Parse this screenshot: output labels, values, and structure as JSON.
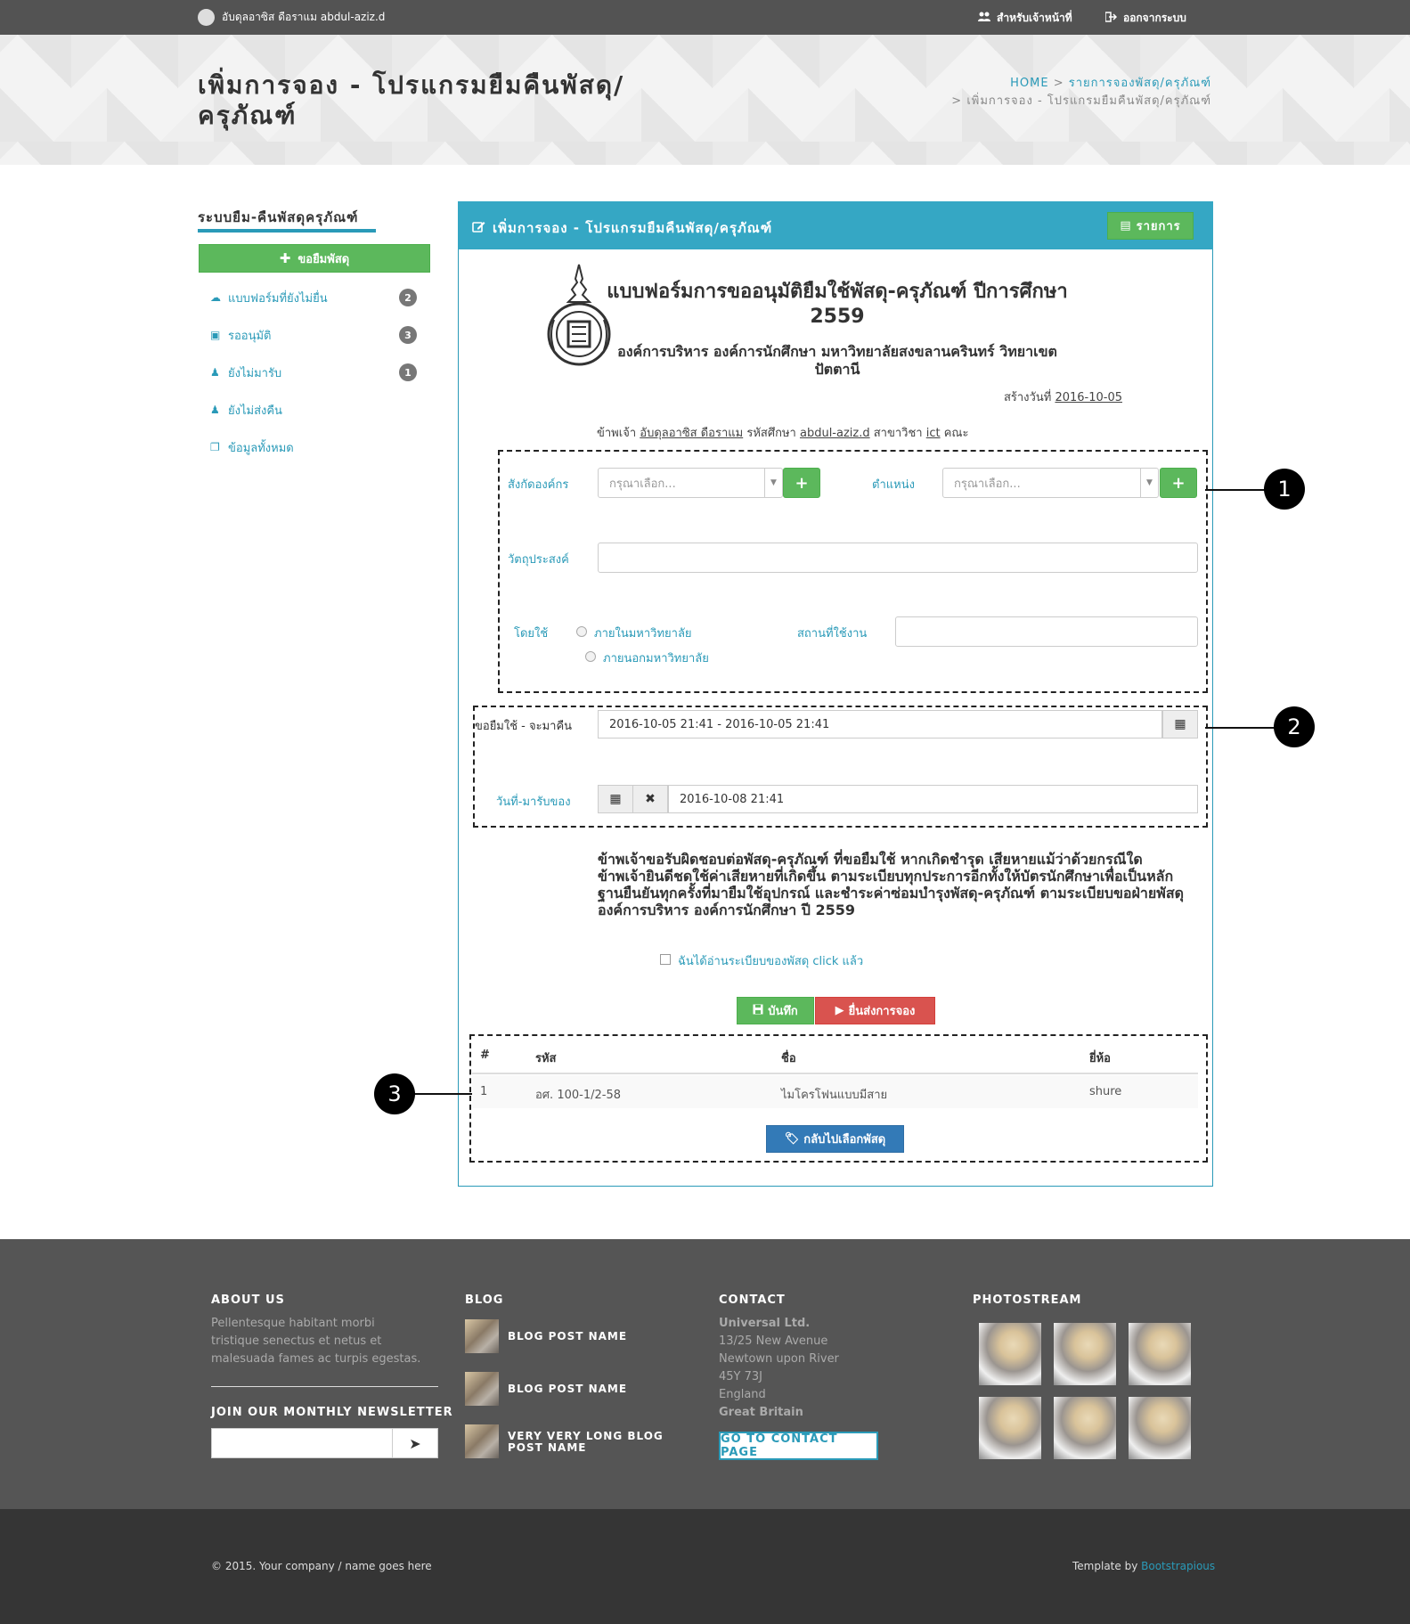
{
  "topbar": {
    "user": "อับดุลอาซิส ดือราแม abdul-aziz.d",
    "staff_link": "สำหรับเจ้าหน้าที่",
    "logout_link": "ออกจากระบบ"
  },
  "header": {
    "title": "เพิ่มการจอง - โปรแกรมยืมคืนพัสดุ/ครุภัณฑ์",
    "breadcrumb": {
      "home": "HOME",
      "list": "รายการจองพัสดุ/ครุภัณฑ์",
      "current": "เพิ่มการจอง - โปรแกรมยืมคืนพัสดุ/ครุภัณฑ์"
    }
  },
  "sidebar": {
    "title": "ระบบยืม-คืนพัสดุครุภัณฑ์",
    "borrow_button": "ขอยืมพัสดุ",
    "items": [
      {
        "label": "แบบฟอร์มที่ยังไม่ยื่น",
        "badge": "2",
        "icon": "cloud-upload-icon"
      },
      {
        "label": "รออนุมัติ",
        "badge": "3",
        "icon": "inbox-icon"
      },
      {
        "label": "ยังไม่มารับ",
        "badge": "1",
        "icon": "user-pickup-icon"
      },
      {
        "label": "ยังไม่ส่งคืน",
        "badge": "",
        "icon": "user-return-icon"
      },
      {
        "label": "ข้อมูลทั้งหมด",
        "badge": "",
        "icon": "files-icon"
      }
    ]
  },
  "panel": {
    "title": "เพิ่มการจอง - โปรแกรมยืมคืนพัสดุ/ครุภัณฑ์",
    "list_button": "รายการ"
  },
  "form": {
    "title": "แบบฟอร์มการขออนุมัติยืมใช้พัสดุ-ครุภัณฑ์ ปีการศึกษา 2559",
    "org": "องค์การบริหาร องค์การนักศึกษา มหาวิทยาลัยสงขลานครินทร์ วิทยาเขตปัตตานี",
    "created_label": "สร้างวันที่",
    "created_date": "2016-10-05",
    "iam_prefix": "ข้าพเจ้า",
    "name": "อับดุลอาซิส ดือราแม",
    "student_id_label": "รหัสศึกษา",
    "student_id": "abdul-aziz.d",
    "major_label": "สาขาวิชา",
    "major": "ict",
    "faculty_label": "คณะ",
    "org_label": "สังกัดองค์กร",
    "org_placeholder": "กรุณาเลือก...",
    "position_label": "ตำแหน่ง",
    "position_placeholder": "กรุณาเลือก...",
    "purpose_label": "วัตถุประสงค์",
    "by_label": "โดยใช้",
    "inside_option": "ภายในมหาวิทยาลัย",
    "outside_option": "ภายนอกมหาวิทยาลัย",
    "location_label": "สถานที่ใช้งาน",
    "borrow_range_label": "ขอยืมใช้ - จะมาคืน",
    "borrow_range_value": "2016-10-05  21:41 - 2016-10-05  21:41",
    "pickup_label": "วันที่-มารับของ",
    "pickup_value": "2016-10-08  21:41",
    "agreement": "ข้าพเจ้าขอรับผิดชอบต่อพัสดุ-ครุภัณฑ์ ที่ขอยืมใช้ หากเกิดชำรุด เสียหายแม้ว่าด้วยกรณีใด ข้าพเจ้ายินดีชดใช้ค่าเสียหายที่เกิดขึ้น ตามระเบียบทุกประการอีกทั้งให้บัตรนักศึกษาเพื่อเป็นหลักฐานยืนยันทุกครั้งที่มายืมใช้อุปกรณ์ และชำระค่าซ่อมบำรุงพัสดุ-ครุภัณฑ์ ตามระเบียบขอฝ่ายพัสดุ องค์การบริหาร องค์การนักศึกษา ปี 2559",
    "checkbox_label": "ฉันได้อ่านระเบียบของพัสดุ click แล้ว",
    "save_button": "บันทึก",
    "submit_button": "ยื่นส่งการจอง",
    "back_button": "กลับไปเลือกพัสดุ"
  },
  "table": {
    "headers": [
      "#",
      "รหัส",
      "ชื่อ",
      "ยี่ห้อ"
    ],
    "rows": [
      [
        "1",
        "อศ. 100-1/2-58",
        "ไมโครโฟนแบบมีสาย",
        "shure"
      ]
    ]
  },
  "callouts": [
    "1",
    "2",
    "3"
  ],
  "footer": {
    "about_title": "ABOUT US",
    "about_text": "Pellentesque habitant morbi tristique senectus et netus et malesuada fames ac turpis egestas.",
    "newsletter_title": "JOIN OUR MONTHLY NEWSLETTER",
    "blog_title": "BLOG",
    "blog_posts": [
      "BLOG POST NAME",
      "BLOG POST NAME",
      "VERY VERY LONG BLOG POST NAME"
    ],
    "contact_title": "CONTACT",
    "contact_lines": [
      "Universal Ltd.",
      "13/25 New Avenue",
      "Newtown upon River",
      "45Y 73J",
      "England",
      "Great Britain"
    ],
    "contact_button": "GO TO CONTACT PAGE",
    "photostream_title": "PHOTOSTREAM",
    "copyright": "© 2015. Your company / name goes here",
    "template_by": "Template by",
    "template_link": "Bootstrapious"
  },
  "colors": {
    "accent": "#35a7c4",
    "success": "#5cb85c",
    "danger": "#d9534f",
    "primary": "#337ab7",
    "footer": "#555555",
    "footer_bottom": "#353535"
  }
}
